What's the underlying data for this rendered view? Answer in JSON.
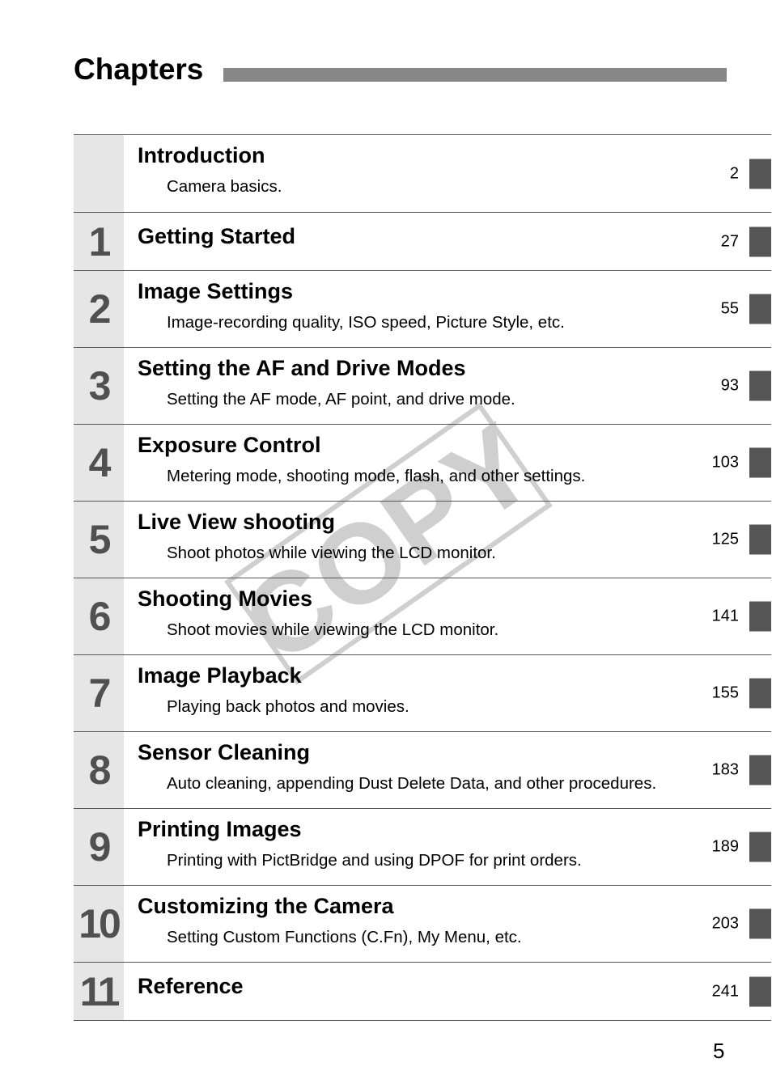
{
  "heading": "Chapters",
  "watermark": "COPY",
  "chapters": [
    {
      "num": "",
      "title": "Introduction",
      "subtitle": "Camera basics.",
      "page": "2"
    },
    {
      "num": "1",
      "title": "Getting Started",
      "subtitle": "",
      "page": "27"
    },
    {
      "num": "2",
      "title": "Image Settings",
      "subtitle": "Image-recording quality, ISO speed, Picture Style, etc.",
      "page": "55"
    },
    {
      "num": "3",
      "title": "Setting the AF and Drive Modes",
      "subtitle": "Setting the AF mode, AF point, and drive mode.",
      "page": "93"
    },
    {
      "num": "4",
      "title": "Exposure Control",
      "subtitle": "Metering mode, shooting mode, flash, and other settings.",
      "page": "103"
    },
    {
      "num": "5",
      "title": "Live View shooting",
      "subtitle": "Shoot photos while viewing the LCD monitor.",
      "page": "125"
    },
    {
      "num": "6",
      "title": "Shooting Movies",
      "subtitle": "Shoot movies while viewing the LCD monitor.",
      "page": "141"
    },
    {
      "num": "7",
      "title": "Image Playback",
      "subtitle": "Playing back photos and movies.",
      "page": "155"
    },
    {
      "num": "8",
      "title": "Sensor Cleaning",
      "subtitle": "Auto cleaning, appending Dust Delete Data, and other procedures.",
      "page": "183"
    },
    {
      "num": "9",
      "title": "Printing Images",
      "subtitle": "Printing with PictBridge and using DPOF for print orders.",
      "page": "189"
    },
    {
      "num": "10",
      "title": "Customizing the Camera",
      "subtitle": "Setting Custom Functions (C.Fn), My Menu, etc.",
      "page": "203"
    },
    {
      "num": "11",
      "title": "Reference",
      "subtitle": "",
      "page": "241"
    }
  ],
  "page_number": "5",
  "colors": {
    "tab": "#555555",
    "number_column": "#e6e6e6",
    "heading_bar": "#878787",
    "watermark": "#cccccc"
  }
}
